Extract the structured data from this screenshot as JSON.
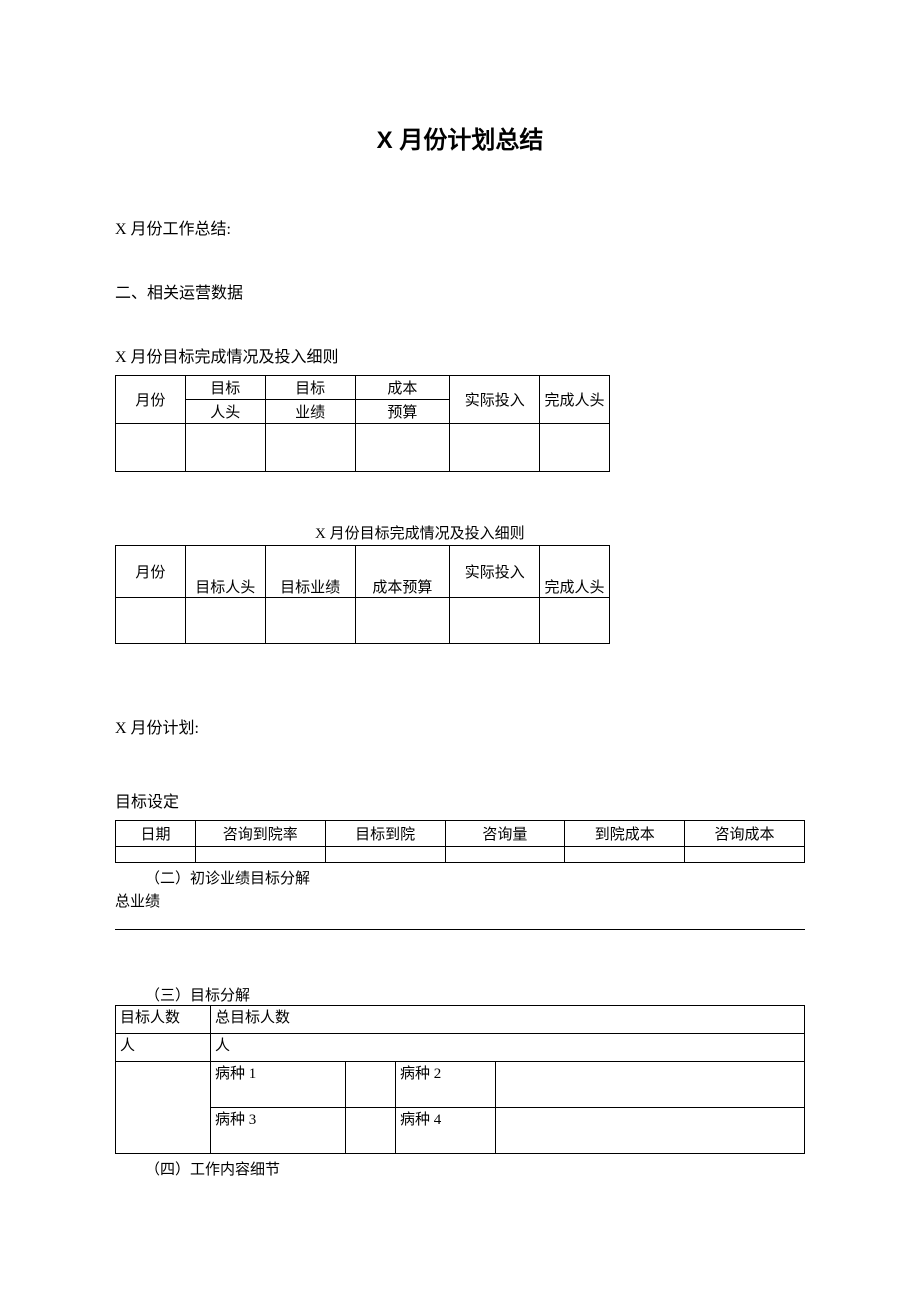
{
  "title": "X 月份计划总结",
  "heading_summary": "X 月份工作总结:",
  "heading_section2": "二、相关运营数据",
  "subheading_table1": "X 月份目标完成情况及投入细则",
  "table1": {
    "headers": {
      "month": "月份",
      "target_head_l1": "目标",
      "target_head_l2": "人头",
      "target_perf_l1": "目标",
      "target_perf_l2": "业绩",
      "cost_l1": "成本",
      "cost_l2": "预算",
      "actual_input": "实际投入",
      "completed_head": "完成人头"
    },
    "row": {
      "month": "",
      "target_head": "",
      "target_perf": "",
      "cost": "",
      "actual_input": "",
      "completed_head": ""
    }
  },
  "caption_table2": "X 月份目标完成情况及投入细则",
  "table2": {
    "headers": {
      "month": "月份",
      "target_head": "目标人头",
      "target_perf": "目标业绩",
      "cost_budget": "成本预算",
      "actual_input": "实际投入",
      "completed_head": "完成人头"
    },
    "row": {
      "month": "",
      "target_head": "",
      "target_perf": "",
      "cost_budget": "",
      "actual_input": "",
      "completed_head": ""
    }
  },
  "heading_plan": "X 月份计划:",
  "subheading_goal": "目标设定",
  "table3": {
    "headers": {
      "date": "日期",
      "consult_rate": "咨询到院率",
      "target_arrival": "目标到院",
      "consult_volume": "咨询量",
      "arrival_cost": "到院成本",
      "consult_cost": "咨询成本"
    },
    "row": {
      "date": "",
      "consult_rate": "",
      "target_arrival": "",
      "consult_volume": "",
      "arrival_cost": "",
      "consult_cost": ""
    }
  },
  "section_ii": "（二）初诊业绩目标分解",
  "total_perf_label": "总业绩",
  "section_iii": "（三）目标分解",
  "table4": {
    "r1c1": "目标人数",
    "r1c2": "总目标人数",
    "r2c1": "人",
    "r2c2": "人",
    "r3c2": "病种 1",
    "r3c4": "病种 2",
    "r4c2": "病种 3",
    "r4c4": "病种 4"
  },
  "section_iv": "（四）工作内容细节"
}
